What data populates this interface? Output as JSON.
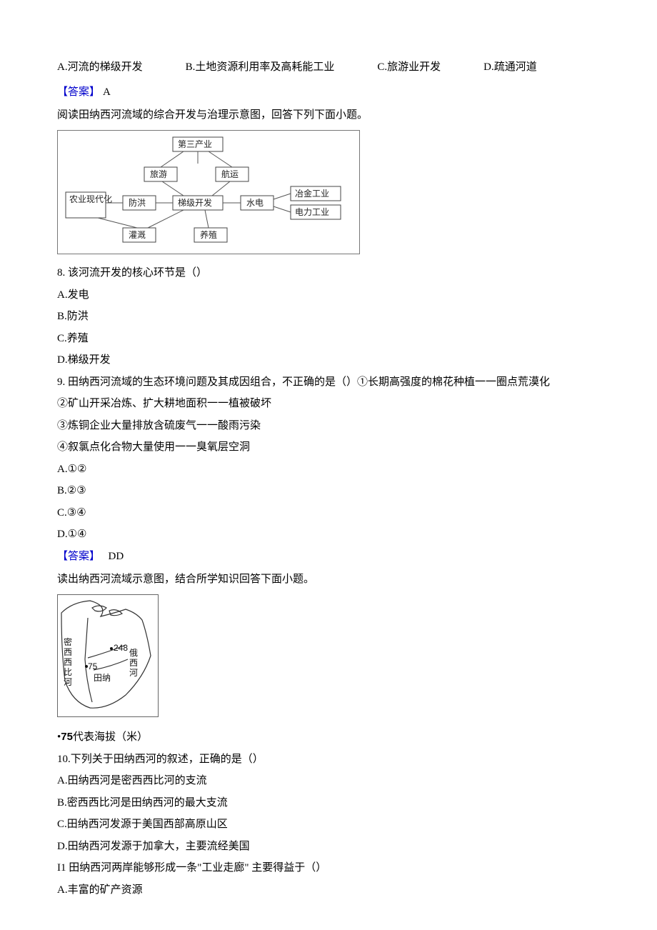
{
  "q7": {
    "optA": "A.河流的梯级开发",
    "optB": "B.土地资源利用率及高耗能工业",
    "optC": "C.旅游业开发",
    "optD": "D.疏通河道"
  },
  "ans7": {
    "label": "【答案】",
    "value": "A"
  },
  "intro1": "阅读田纳西河流域的综合开发与治理示意图，回答下列下面小题。",
  "diagram": {
    "top": "第三产业",
    "tourism": "旅游",
    "shipping": "航运",
    "agri": "农业现代化",
    "flood": "防洪",
    "cascade": "梯级开发",
    "hydro": "水电",
    "metal": "冶金工业",
    "power": "电力工业",
    "irrigation": "灌溉",
    "farming": "养殖"
  },
  "q8": {
    "stem": "8. 该河流开发的核心环节是（）",
    "optA": "A.发电",
    "optB": "B.防洪",
    "optC": "C.养殖",
    "optD": "D.梯级开发"
  },
  "q9": {
    "stem": "9. 田纳西河流域的生态环境问题及其成因组合，不正确的是（）①长期高强度的棉花种植一一圈点荒漠化",
    "line2": "②矿山开采冶炼、扩大耕地面积一一植被破坏",
    "line3": "③炼铜企业大量排放含硫废气一一酸雨污染",
    "line4": "④叙氯点化合物大量使用一一臭氧层空洞",
    "optA": "A.①②",
    "optB": "B.②③",
    "optC": "C.③④",
    "optD": "D.①④"
  },
  "ans89": {
    "label": "【答案】",
    "value": "DD"
  },
  "intro2": "读出纳西河流域示意图，结合所学知识回答下面小题。",
  "map": {
    "river1a": "密",
    "river1b": "西",
    "river1c": "西",
    "river1d": "比",
    "river1e": "河",
    "num248": "248",
    "num75": "75",
    "tian": "田纳",
    "ohio1": "俄",
    "ohio2": "西",
    "ohio3": "河"
  },
  "note75": {
    "bullet": "•",
    "bold": "75",
    "rest": "代表海拔（米）"
  },
  "q10": {
    "stem": "10.下列关于田纳西河的叙述，正确的是（）",
    "optA": "A.田纳西河是密西西比河的支流",
    "optB": "B.密西西比河是田纳西河的最大支流",
    "optC": "C.田纳西河发源于美国西部高原山区",
    "optD": "D.田纳西河发源于加拿大，主要流经美国"
  },
  "q11": {
    "stem": "I1 田纳西河两岸能够形成一条\"工业走廊\" 主要得益于（）",
    "optA": "A.丰富的矿产资源"
  }
}
